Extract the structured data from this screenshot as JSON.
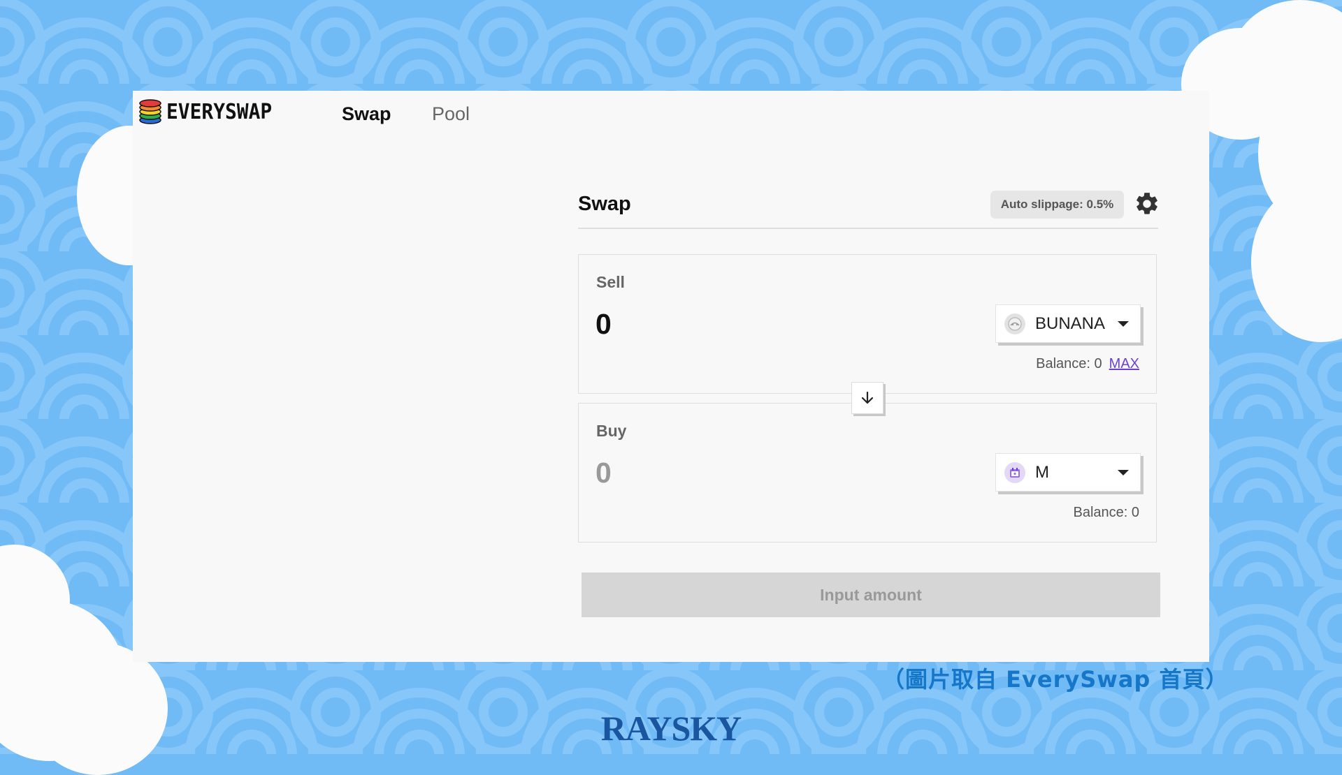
{
  "colors": {
    "background": "#70baf6",
    "pattern": "#8ccaf9",
    "panel": "#f8f8f8",
    "accent_link": "#6a40d8",
    "caption": "#1677c9",
    "footer": "#1a55a0"
  },
  "nav": {
    "brand": "EVERYSWAP",
    "brand_logo_icon": "stacked-rings-logo-icon",
    "tabs": [
      {
        "label": "Swap",
        "active": true
      },
      {
        "label": "Pool",
        "active": false
      }
    ]
  },
  "swap": {
    "title": "Swap",
    "slippage": "Auto slippage: 0.5%",
    "settings_icon": "gear-icon",
    "sell": {
      "label": "Sell",
      "amount_placeholder": "0",
      "token": "BUNANA",
      "token_icon": "bunana-token-icon",
      "balance": "Balance: 0",
      "max_label": "MAX"
    },
    "flip_icon": "arrow-down-icon",
    "buy": {
      "label": "Buy",
      "amount_placeholder": "0",
      "token": "M",
      "token_icon": "calendar-token-icon",
      "balance": "Balance: 0"
    },
    "action_label": "Input amount"
  },
  "caption": "（圖片取自 EverySwap 首頁）",
  "footer_brand": "RAYSKY"
}
